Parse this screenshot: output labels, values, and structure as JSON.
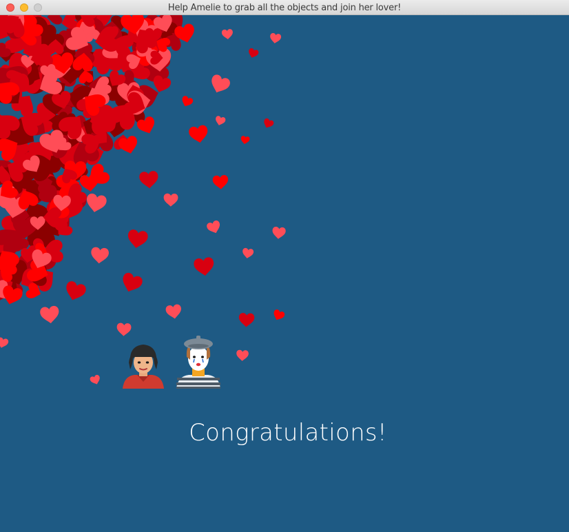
{
  "window": {
    "title": "Help Amelie to grab all the objects and join her lover!"
  },
  "scene": {
    "background_color": "#1e5a84",
    "message": "Congratulations!",
    "heart_colors": [
      "#8b0000",
      "#b00010",
      "#d80010",
      "#ff0000",
      "#ff4d57"
    ],
    "characters": [
      {
        "name": "amelie",
        "icon": "woman-red-shirt-icon"
      },
      {
        "name": "lover",
        "icon": "mime-striped-shirt-icon"
      }
    ]
  }
}
